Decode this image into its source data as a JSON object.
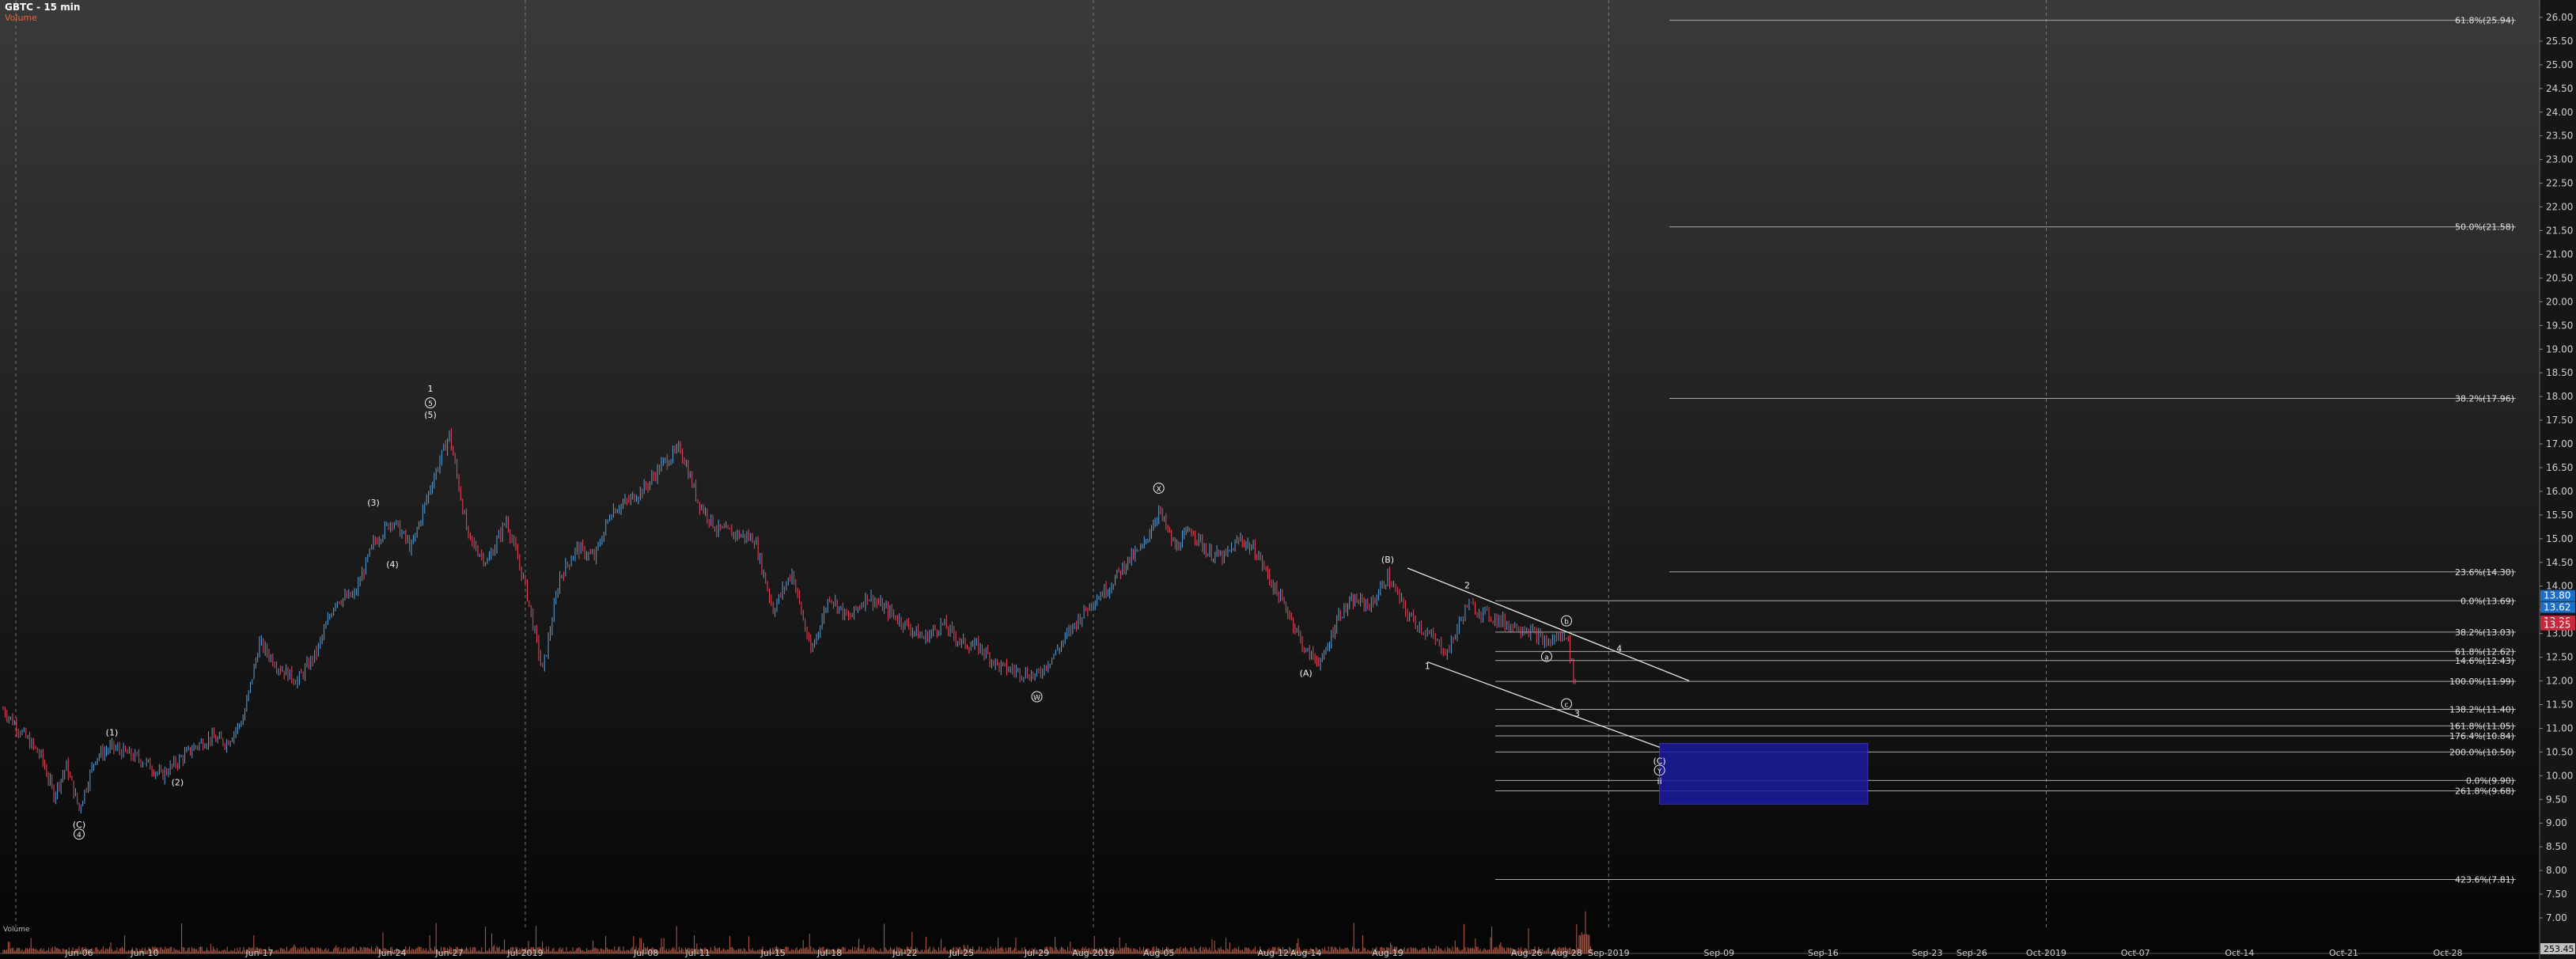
{
  "header": {
    "title": "GBTC - 15 min",
    "indicator": "Volume"
  },
  "colors": {
    "up": "#5aa0d8",
    "down": "#e8485a",
    "volume": "#d86a50",
    "target_box": "#1a1a9e",
    "price_tag_up": "#1e6fc8",
    "price_tag_down": "#c8283c"
  },
  "chart_data": {
    "type": "candlestick",
    "xlabel": "",
    "ylabel": "",
    "ylim": [
      6.8,
      26.3
    ],
    "x_ticks": [
      "Jun-06",
      "Jun-10",
      "Jun-17",
      "Jun-24",
      "Jun-27",
      "Jul-2019",
      "Jul-08",
      "Jul-11",
      "Jul-15",
      "Jul-18",
      "Jul-22",
      "Jul-25",
      "Jul-29",
      "Aug-2019",
      "Aug-05",
      "Aug-12",
      "Aug-14",
      "Aug-19",
      "Aug-26",
      "Aug-28",
      "Sep-2019",
      "Sep-09",
      "Sep-16",
      "Sep-23",
      "Sep-26",
      "Oct-2019",
      "Oct-07",
      "Oct-14",
      "Oct-21",
      "Oct-28"
    ],
    "month_dividers": [
      "Jun-2019",
      "Jul-2019",
      "Aug-2019",
      "Sep-2019",
      "Oct-2019"
    ],
    "y_ticks": [
      7.0,
      7.5,
      8.0,
      8.5,
      9.0,
      9.5,
      10.0,
      10.5,
      11.0,
      11.5,
      12.0,
      12.5,
      13.0,
      13.5,
      14.0,
      14.5,
      15.0,
      15.5,
      16.0,
      16.5,
      17.0,
      17.5,
      18.0,
      18.5,
      19.0,
      19.5,
      20.0,
      20.5,
      21.0,
      21.5,
      22.0,
      22.5,
      23.0,
      23.5,
      24.0,
      24.5,
      25.0,
      25.5,
      26.0
    ],
    "price_path": [
      [
        "May-31",
        11.4
      ],
      [
        "Jun-03",
        10.4
      ],
      [
        "Jun-04",
        9.6
      ],
      [
        "Jun-05",
        10.2
      ],
      [
        "Jun-06",
        9.3
      ],
      [
        "Jun-07",
        10.4
      ],
      [
        "Jun-08",
        10.6
      ],
      [
        "Jun-10",
        10.3
      ],
      [
        "Jun-11",
        10.0
      ],
      [
        "Jun-12",
        10.3
      ],
      [
        "Jun-13",
        10.6
      ],
      [
        "Jun-14",
        10.8
      ],
      [
        "Jun-15",
        10.7
      ],
      [
        "Jun-16",
        11.2
      ],
      [
        "Jun-17",
        12.8
      ],
      [
        "Jun-18",
        12.3
      ],
      [
        "Jun-19",
        12.0
      ],
      [
        "Jun-20",
        12.6
      ],
      [
        "Jun-21",
        13.7
      ],
      [
        "Jun-22",
        13.8
      ],
      [
        "Jun-23",
        14.9
      ],
      [
        "Jun-24",
        15.4
      ],
      [
        "Jun-25",
        14.8
      ],
      [
        "Jun-26",
        16.1
      ],
      [
        "Jun-27",
        17.2
      ],
      [
        "Jun-28",
        15.0
      ],
      [
        "Jun-29",
        14.5
      ],
      [
        "Jun-30",
        15.4
      ],
      [
        "Jul-01",
        14.0
      ],
      [
        "Jul-02",
        12.2
      ],
      [
        "Jul-03",
        14.2
      ],
      [
        "Jul-04",
        14.8
      ],
      [
        "Jul-05",
        14.6
      ],
      [
        "Jul-06",
        15.6
      ],
      [
        "Jul-07",
        15.8
      ],
      [
        "Jul-08",
        16.1
      ],
      [
        "Jul-09",
        16.6
      ],
      [
        "Jul-10",
        16.9
      ],
      [
        "Jul-11",
        15.8
      ],
      [
        "Jul-12",
        15.2
      ],
      [
        "Jul-13",
        15.1
      ],
      [
        "Jul-14",
        15.0
      ],
      [
        "Jul-15",
        13.5
      ],
      [
        "Jul-16",
        14.3
      ],
      [
        "Jul-17",
        12.6
      ],
      [
        "Jul-18",
        13.8
      ],
      [
        "Jul-19",
        13.3
      ],
      [
        "Jul-20",
        13.8
      ],
      [
        "Jul-21",
        13.5
      ],
      [
        "Jul-22",
        13.2
      ],
      [
        "Jul-23",
        12.9
      ],
      [
        "Jul-24",
        13.2
      ],
      [
        "Jul-25",
        12.8
      ],
      [
        "Jul-26",
        12.7
      ],
      [
        "Jul-27",
        12.3
      ],
      [
        "Jul-29",
        12.1
      ],
      [
        "Jul-30",
        12.6
      ],
      [
        "Jul-31",
        13.2
      ],
      [
        "Aug-01",
        13.7
      ],
      [
        "Aug-02",
        14.0
      ],
      [
        "Aug-03",
        14.5
      ],
      [
        "Aug-04",
        14.8
      ],
      [
        "Aug-05",
        15.6
      ],
      [
        "Aug-06",
        14.8
      ],
      [
        "Aug-07",
        15.2
      ],
      [
        "Aug-08",
        14.7
      ],
      [
        "Aug-09",
        14.6
      ],
      [
        "Aug-10",
        15.0
      ],
      [
        "Aug-11",
        14.7
      ],
      [
        "Aug-12",
        14.0
      ],
      [
        "Aug-13",
        13.4
      ],
      [
        "Aug-14",
        12.6
      ],
      [
        "Aug-15",
        12.4
      ],
      [
        "Aug-16",
        13.4
      ],
      [
        "Aug-17",
        13.7
      ],
      [
        "Aug-18",
        13.6
      ],
      [
        "Aug-19",
        14.2
      ],
      [
        "Aug-20",
        13.4
      ],
      [
        "Aug-21",
        13.0
      ],
      [
        "Aug-22",
        12.6
      ],
      [
        "Aug-23",
        13.6
      ],
      [
        "Aug-24",
        13.4
      ],
      [
        "Aug-25",
        13.2
      ],
      [
        "Aug-26",
        13.1
      ],
      [
        "Aug-27",
        12.8
      ],
      [
        "Aug-28",
        13.0
      ],
      [
        "Aug-29",
        11.7
      ]
    ],
    "fib_levels": [
      {
        "label": "61.8%(25.94)",
        "value": 25.94
      },
      {
        "label": "50.0%(21.58)",
        "value": 21.58
      },
      {
        "label": "38.2%(17.96)",
        "value": 17.96
      },
      {
        "label": "23.6%(14.30)",
        "value": 14.3
      },
      {
        "label": "0.0%(13.69)",
        "value": 13.69
      },
      {
        "label": "38.2%(13.03)",
        "value": 13.03
      },
      {
        "label": "61.8%(12.62)",
        "value": 12.62
      },
      {
        "label": "14.6%(12.43)",
        "value": 12.43
      },
      {
        "label": "100.0%(11.99)",
        "value": 11.99
      },
      {
        "label": "138.2%(11.40)",
        "value": 11.4
      },
      {
        "label": "161.8%(11.05)",
        "value": 11.05
      },
      {
        "label": "176.4%(10.84)",
        "value": 10.84
      },
      {
        "label": "200.0%(10.50)",
        "value": 10.5
      },
      {
        "label": "0.0%(9.90)",
        "value": 9.9
      },
      {
        "label": "261.8%(9.68)",
        "value": 9.68
      },
      {
        "label": "423.6%(7.81)",
        "value": 7.81
      }
    ],
    "price_tags": [
      {
        "label": "13.80",
        "value": 13.8,
        "kind": "up"
      },
      {
        "label": "13.62",
        "value": 13.62,
        "kind": "up"
      },
      {
        "label": "13.26",
        "value": 13.26,
        "kind": "down"
      },
      {
        "label": "13.25",
        "value": 13.25,
        "kind": "down"
      }
    ],
    "volume_axis_label": "253.45",
    "volume_overlay_label": "Volume",
    "target_box": {
      "x_start": "Sep-05",
      "x_end": "Sep-19",
      "y_low": 9.4,
      "y_high": 10.68
    },
    "trend_lines": [
      {
        "from": [
          "Aug-20",
          14.38
        ],
        "to": [
          "Sep-07",
          12.0
        ]
      },
      {
        "from": [
          "Aug-21",
          12.4
        ],
        "to": [
          "Sep-05",
          10.6
        ]
      }
    ],
    "wave_labels": [
      {
        "text": "(C)",
        "x": "Jun-06",
        "y": 8.9
      },
      {
        "text": "4",
        "x": "Jun-06",
        "y": 8.7,
        "circled": true
      },
      {
        "text": "(1)",
        "x": "Jun-08",
        "y": 10.85
      },
      {
        "text": "(2)",
        "x": "Jun-12",
        "y": 9.8
      },
      {
        "text": "(3)",
        "x": "Jun-23",
        "y": 15.7
      },
      {
        "text": "(4)",
        "x": "Jun-24",
        "y": 14.4
      },
      {
        "text": "(5)",
        "x": "Jun-26",
        "y": 17.55
      },
      {
        "text": "5",
        "x": "Jun-26",
        "y": 17.8,
        "circled": true
      },
      {
        "text": "1",
        "x": "Jun-26",
        "y": 18.1
      },
      {
        "text": "W",
        "x": "Jul-29",
        "y": 11.6,
        "circled": true
      },
      {
        "text": "X",
        "x": "Aug-05",
        "y": 16.0,
        "circled": true
      },
      {
        "text": "(A)",
        "x": "Aug-14",
        "y": 12.1
      },
      {
        "text": "(B)",
        "x": "Aug-19",
        "y": 14.5
      },
      {
        "text": "1",
        "x": "Aug-21",
        "y": 12.25
      },
      {
        "text": "2",
        "x": "Aug-23",
        "y": 13.95
      },
      {
        "text": "a",
        "x": "Aug-27",
        "y": 12.45,
        "circled": true
      },
      {
        "text": "b",
        "x": "Aug-28",
        "y": 13.2,
        "circled": true
      },
      {
        "text": "c",
        "x": "Aug-28",
        "y": 11.45,
        "circled": true
      },
      {
        "text": "3",
        "x": "Aug-29",
        "y": 11.25
      },
      {
        "text": "4",
        "x": "Sep-02",
        "y": 12.62
      },
      {
        "text": "(C)",
        "x": "Sep-05",
        "y": 10.25
      },
      {
        "text": "Y",
        "x": "Sep-05",
        "y": 10.05,
        "circled": true
      },
      {
        "text": "ii",
        "x": "Sep-05",
        "y": 9.82
      }
    ]
  }
}
